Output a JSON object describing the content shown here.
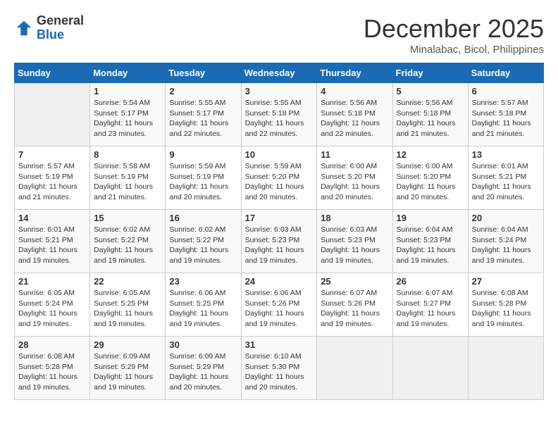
{
  "header": {
    "logo_general": "General",
    "logo_blue": "Blue",
    "month_title": "December 2025",
    "location": "Minalabac, Bicol, Philippines"
  },
  "days_of_week": [
    "Sunday",
    "Monday",
    "Tuesday",
    "Wednesday",
    "Thursday",
    "Friday",
    "Saturday"
  ],
  "weeks": [
    [
      {
        "day": "",
        "sunrise": "",
        "sunset": "",
        "daylight": ""
      },
      {
        "day": "1",
        "sunrise": "Sunrise: 5:54 AM",
        "sunset": "Sunset: 5:17 PM",
        "daylight": "Daylight: 11 hours and 23 minutes."
      },
      {
        "day": "2",
        "sunrise": "Sunrise: 5:55 AM",
        "sunset": "Sunset: 5:17 PM",
        "daylight": "Daylight: 11 hours and 22 minutes."
      },
      {
        "day": "3",
        "sunrise": "Sunrise: 5:55 AM",
        "sunset": "Sunset: 5:18 PM",
        "daylight": "Daylight: 11 hours and 22 minutes."
      },
      {
        "day": "4",
        "sunrise": "Sunrise: 5:56 AM",
        "sunset": "Sunset: 5:18 PM",
        "daylight": "Daylight: 11 hours and 22 minutes."
      },
      {
        "day": "5",
        "sunrise": "Sunrise: 5:56 AM",
        "sunset": "Sunset: 5:18 PM",
        "daylight": "Daylight: 11 hours and 21 minutes."
      },
      {
        "day": "6",
        "sunrise": "Sunrise: 5:57 AM",
        "sunset": "Sunset: 5:18 PM",
        "daylight": "Daylight: 11 hours and 21 minutes."
      }
    ],
    [
      {
        "day": "7",
        "sunrise": "Sunrise: 5:57 AM",
        "sunset": "Sunset: 5:19 PM",
        "daylight": "Daylight: 11 hours and 21 minutes."
      },
      {
        "day": "8",
        "sunrise": "Sunrise: 5:58 AM",
        "sunset": "Sunset: 5:19 PM",
        "daylight": "Daylight: 11 hours and 21 minutes."
      },
      {
        "day": "9",
        "sunrise": "Sunrise: 5:59 AM",
        "sunset": "Sunset: 5:19 PM",
        "daylight": "Daylight: 11 hours and 20 minutes."
      },
      {
        "day": "10",
        "sunrise": "Sunrise: 5:59 AM",
        "sunset": "Sunset: 5:20 PM",
        "daylight": "Daylight: 11 hours and 20 minutes."
      },
      {
        "day": "11",
        "sunrise": "Sunrise: 6:00 AM",
        "sunset": "Sunset: 5:20 PM",
        "daylight": "Daylight: 11 hours and 20 minutes."
      },
      {
        "day": "12",
        "sunrise": "Sunrise: 6:00 AM",
        "sunset": "Sunset: 5:20 PM",
        "daylight": "Daylight: 11 hours and 20 minutes."
      },
      {
        "day": "13",
        "sunrise": "Sunrise: 6:01 AM",
        "sunset": "Sunset: 5:21 PM",
        "daylight": "Daylight: 11 hours and 20 minutes."
      }
    ],
    [
      {
        "day": "14",
        "sunrise": "Sunrise: 6:01 AM",
        "sunset": "Sunset: 5:21 PM",
        "daylight": "Daylight: 11 hours and 19 minutes."
      },
      {
        "day": "15",
        "sunrise": "Sunrise: 6:02 AM",
        "sunset": "Sunset: 5:22 PM",
        "daylight": "Daylight: 11 hours and 19 minutes."
      },
      {
        "day": "16",
        "sunrise": "Sunrise: 6:02 AM",
        "sunset": "Sunset: 5:22 PM",
        "daylight": "Daylight: 11 hours and 19 minutes."
      },
      {
        "day": "17",
        "sunrise": "Sunrise: 6:03 AM",
        "sunset": "Sunset: 5:23 PM",
        "daylight": "Daylight: 11 hours and 19 minutes."
      },
      {
        "day": "18",
        "sunrise": "Sunrise: 6:03 AM",
        "sunset": "Sunset: 5:23 PM",
        "daylight": "Daylight: 11 hours and 19 minutes."
      },
      {
        "day": "19",
        "sunrise": "Sunrise: 6:04 AM",
        "sunset": "Sunset: 5:23 PM",
        "daylight": "Daylight: 11 hours and 19 minutes."
      },
      {
        "day": "20",
        "sunrise": "Sunrise: 6:04 AM",
        "sunset": "Sunset: 5:24 PM",
        "daylight": "Daylight: 11 hours and 19 minutes."
      }
    ],
    [
      {
        "day": "21",
        "sunrise": "Sunrise: 6:05 AM",
        "sunset": "Sunset: 5:24 PM",
        "daylight": "Daylight: 11 hours and 19 minutes."
      },
      {
        "day": "22",
        "sunrise": "Sunrise: 6:05 AM",
        "sunset": "Sunset: 5:25 PM",
        "daylight": "Daylight: 11 hours and 19 minutes."
      },
      {
        "day": "23",
        "sunrise": "Sunrise: 6:06 AM",
        "sunset": "Sunset: 5:25 PM",
        "daylight": "Daylight: 11 hours and 19 minutes."
      },
      {
        "day": "24",
        "sunrise": "Sunrise: 6:06 AM",
        "sunset": "Sunset: 5:26 PM",
        "daylight": "Daylight: 11 hours and 19 minutes."
      },
      {
        "day": "25",
        "sunrise": "Sunrise: 6:07 AM",
        "sunset": "Sunset: 5:26 PM",
        "daylight": "Daylight: 11 hours and 19 minutes."
      },
      {
        "day": "26",
        "sunrise": "Sunrise: 6:07 AM",
        "sunset": "Sunset: 5:27 PM",
        "daylight": "Daylight: 11 hours and 19 minutes."
      },
      {
        "day": "27",
        "sunrise": "Sunrise: 6:08 AM",
        "sunset": "Sunset: 5:28 PM",
        "daylight": "Daylight: 11 hours and 19 minutes."
      }
    ],
    [
      {
        "day": "28",
        "sunrise": "Sunrise: 6:08 AM",
        "sunset": "Sunset: 5:28 PM",
        "daylight": "Daylight: 11 hours and 19 minutes."
      },
      {
        "day": "29",
        "sunrise": "Sunrise: 6:09 AM",
        "sunset": "Sunset: 5:29 PM",
        "daylight": "Daylight: 11 hours and 19 minutes."
      },
      {
        "day": "30",
        "sunrise": "Sunrise: 6:09 AM",
        "sunset": "Sunset: 5:29 PM",
        "daylight": "Daylight: 11 hours and 20 minutes."
      },
      {
        "day": "31",
        "sunrise": "Sunrise: 6:10 AM",
        "sunset": "Sunset: 5:30 PM",
        "daylight": "Daylight: 11 hours and 20 minutes."
      },
      {
        "day": "",
        "sunrise": "",
        "sunset": "",
        "daylight": ""
      },
      {
        "day": "",
        "sunrise": "",
        "sunset": "",
        "daylight": ""
      },
      {
        "day": "",
        "sunrise": "",
        "sunset": "",
        "daylight": ""
      }
    ]
  ]
}
